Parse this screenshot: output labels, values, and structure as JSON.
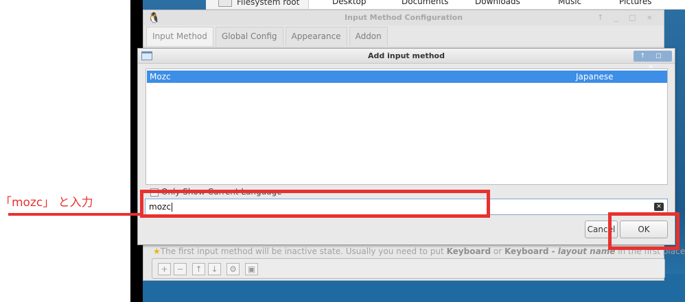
{
  "file_manager": {
    "sidebar_item": "Filesystem root",
    "folders": [
      "Desktop",
      "Documents",
      "Downloads",
      "Music",
      "Pictures"
    ]
  },
  "config_window": {
    "title": "Input Method Configuration",
    "title_icon": "penguin-icon",
    "window_controls": "↑ _ □ ×",
    "tabs": [
      "Input Method",
      "Global Config",
      "Appearance",
      "Addon"
    ],
    "hint_prefix": "The first input method will be inactive state. Usually you need to put ",
    "hint_kbd1": "Keyboard",
    "hint_or": " or ",
    "hint_kbd2": "Keyboard - ",
    "hint_layout": "layout name",
    "hint_suffix": " in the first place.",
    "toolbar_buttons": [
      "+",
      "−",
      "↑",
      "↓",
      "⚙",
      "▣"
    ]
  },
  "dialog": {
    "title": "Add input method",
    "window_controls": "↑ □ ×",
    "list": [
      {
        "name": "Mozc",
        "language": "Japanese",
        "selected": true
      }
    ],
    "only_show_current_language": "Only Show Current Language",
    "search_value": "mozc",
    "cancel_label": "Cancel",
    "ok_label": "OK"
  },
  "annotation": {
    "label": "「mozc」 と入力",
    "color": "#e8312f"
  },
  "colors": {
    "selection": "#3d8ee6",
    "annotation": "#e8312f"
  }
}
